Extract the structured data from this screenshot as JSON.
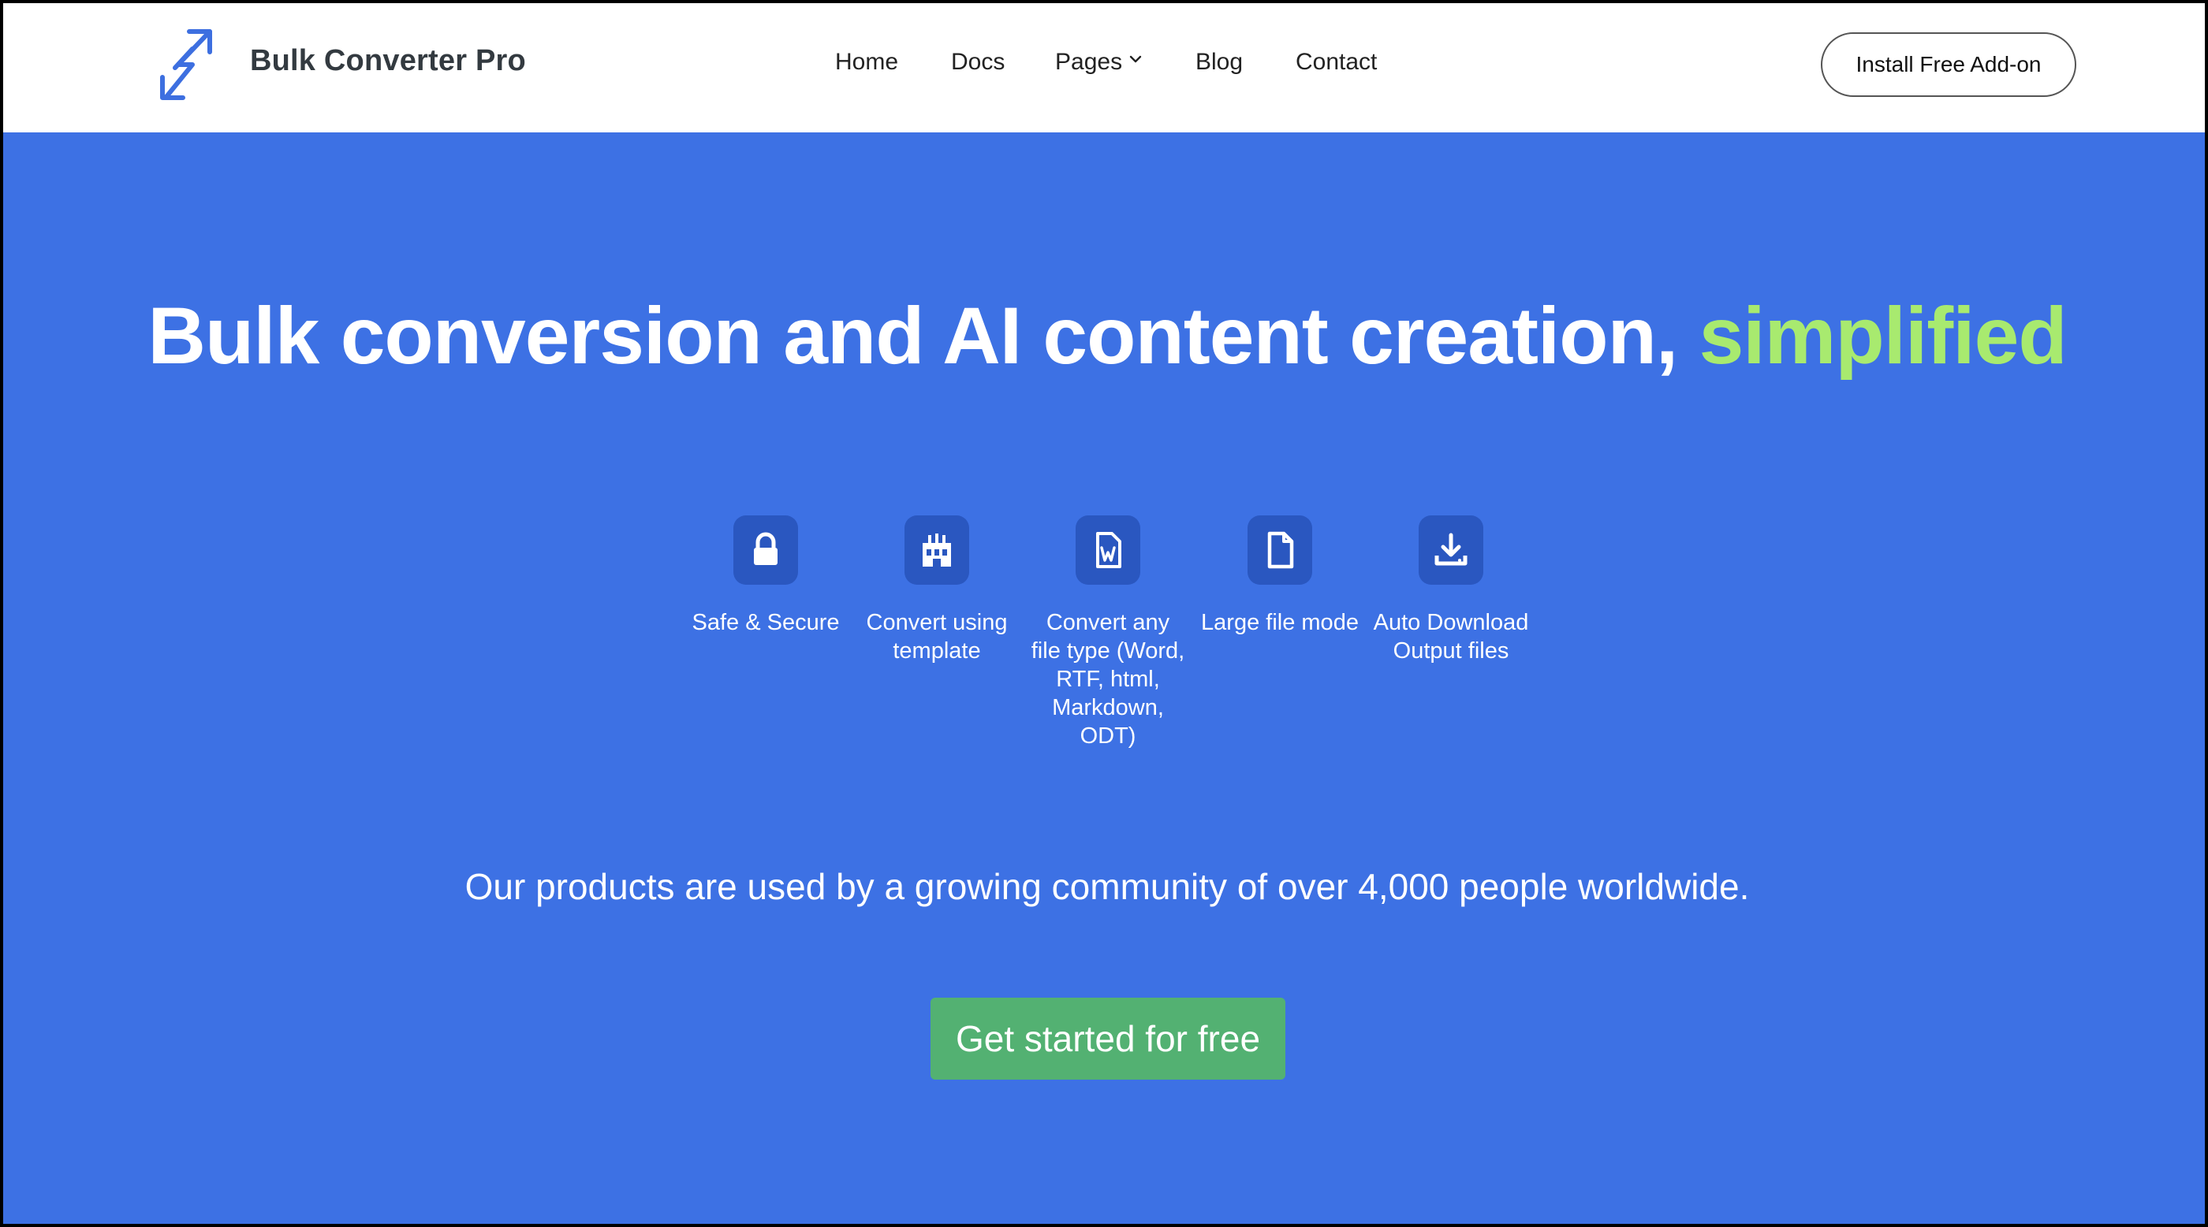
{
  "header": {
    "brand": "Bulk Converter Pro",
    "nav": [
      "Home",
      "Docs",
      "Pages",
      "Blog",
      "Contact"
    ],
    "install_button": "Install Free Add-on"
  },
  "hero": {
    "headline_main": "Bulk conversion and AI content creation, ",
    "headline_accent": "simplified",
    "features": [
      {
        "icon": "lock-icon",
        "label": "Safe & Secure"
      },
      {
        "icon": "template-icon",
        "label": "Convert using template"
      },
      {
        "icon": "word-document-icon",
        "label": "Convert any file type (Word, RTF, html, Markdown, ODT)"
      },
      {
        "icon": "file-icon",
        "label": "Large file mode"
      },
      {
        "icon": "download-icon",
        "label": "Auto Download Output files"
      }
    ],
    "community_text": "Our products are used by a growing community of over 4,000 people worldwide.",
    "cta_button": "Get started for free"
  },
  "colors": {
    "hero_background": "#3d71e4",
    "accent_text": "#a8ea6f",
    "feature_icon_bg": "#2a57c0",
    "cta_background": "#53b172",
    "logo_blue": "#3d6fe0"
  }
}
